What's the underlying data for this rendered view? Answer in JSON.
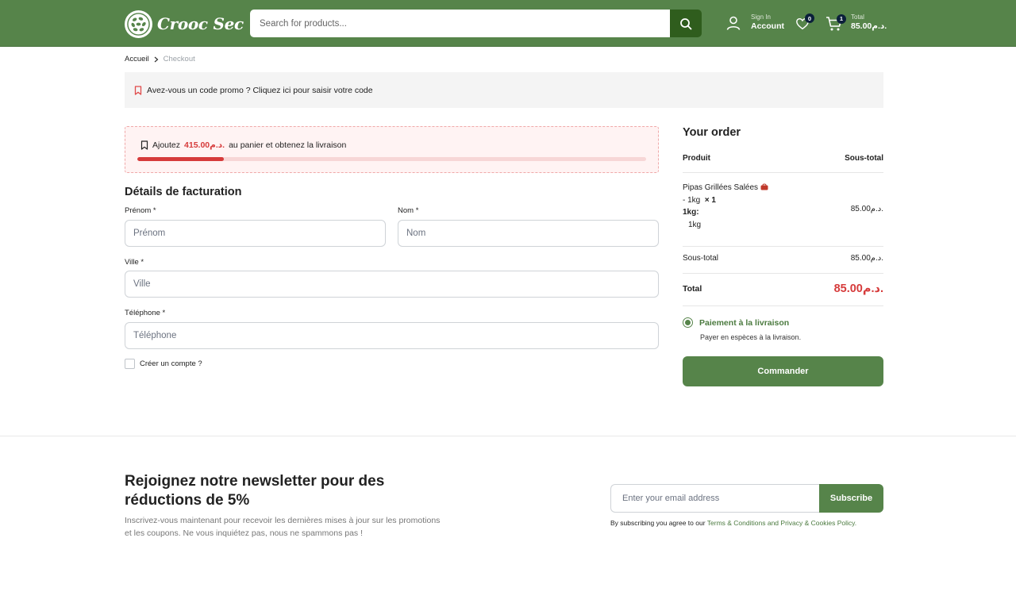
{
  "header": {
    "brand": "Crooc Sec",
    "search_placeholder": "Search for products...",
    "account_small": "Sign In",
    "account_big": "Account",
    "wishlist_count": "0",
    "cart_count": "1",
    "cart_small": "Total",
    "cart_total": "85.00د.م."
  },
  "breadcrumb": {
    "home": "Accueil",
    "current": "Checkout"
  },
  "promo": {
    "text": "Avez-vous un code promo ? Cliquez ici pour saisir votre code"
  },
  "shipping": {
    "prefix": "Ajoutez",
    "amount": "415.00د.م.",
    "suffix": "au panier et obtenez la livraison",
    "progress_fraction": 0.17
  },
  "billing": {
    "title": "Détails de facturation",
    "first_name_label": "Prénom *",
    "first_name_placeholder": "Prénom",
    "last_name_label": "Nom *",
    "last_name_placeholder": "Nom",
    "city_label": "Ville *",
    "city_placeholder": "Ville",
    "phone_label": "Téléphone *",
    "phone_placeholder": "Téléphone",
    "create_account": "Créer un compte ?"
  },
  "order": {
    "title": "Your order",
    "col_product": "Produit",
    "col_subtotal": "Sous-total",
    "item": {
      "name": "Pipas Grillées Salées",
      "variant": "- 1kg",
      "qty": "× 1",
      "attr_label": "1kg:",
      "attr_value": "1kg",
      "price": "85.00د.م."
    },
    "subtotal_label": "Sous-total",
    "subtotal_value": "85.00د.م.",
    "total_label": "Total",
    "total_value": "85.00د.م.",
    "payment_label": "Paiement à la livraison",
    "payment_desc": "Payer en espèces à la livraison.",
    "submit": "Commander"
  },
  "newsletter": {
    "title": "Rejoignez notre newsletter pour des réductions de 5%",
    "desc": "Inscrivez-vous maintenant pour recevoir les dernières mises à jour sur les promotions et les coupons. Ne vous inquiétez pas, nous ne spammons pas !",
    "email_placeholder": "Enter your email address",
    "subscribe": "Subscribe",
    "terms_prefix": "By subscribing you agree to our",
    "terms_link": "Terms & Conditions",
    "terms_and": "and",
    "privacy_link": "Privacy & Cookies Policy."
  },
  "colors": {
    "brand_green": "#56844a",
    "dark_green": "#2f5d1d",
    "accent_red": "#d63b3b"
  }
}
